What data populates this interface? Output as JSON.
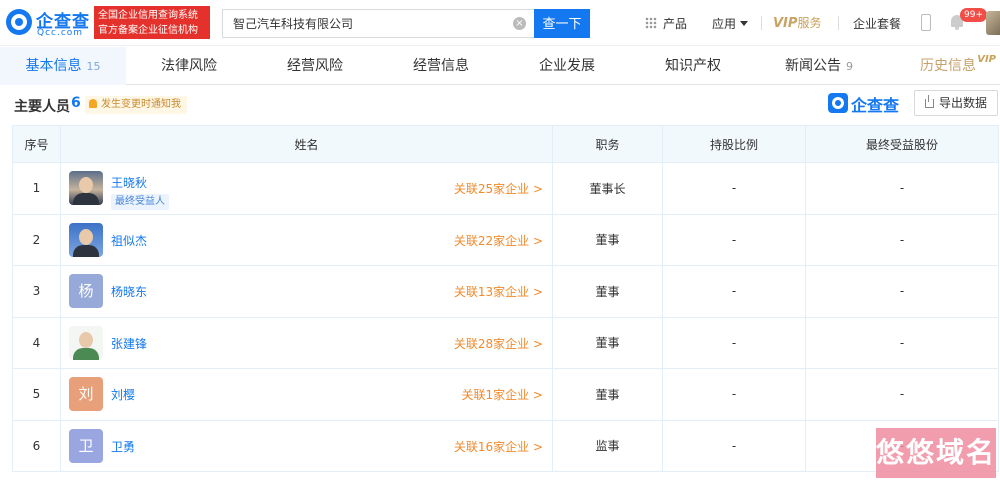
{
  "header": {
    "logo_text": "企查查",
    "logo_sub": "Qcc.com",
    "cert_line1": "全国企业信用查询系统",
    "cert_line2": "官方备案企业征信机构",
    "search_value": "智己汽车科技有限公司",
    "search_button": "查一下",
    "nav_products": "产品",
    "nav_apps": "应用",
    "nav_vip_prefix": "VIP",
    "nav_vip_suffix": "服务",
    "nav_package": "企业套餐",
    "notification_badge": "99+",
    "icons": [
      "grid-icon",
      "caret-down-icon",
      "phone-icon",
      "bell-icon",
      "clear-icon"
    ]
  },
  "tabs": [
    {
      "label": "基本信息",
      "count": "15"
    },
    {
      "label": "法律风险",
      "count": ""
    },
    {
      "label": "经营风险",
      "count": ""
    },
    {
      "label": "经营信息",
      "count": ""
    },
    {
      "label": "企业发展",
      "count": ""
    },
    {
      "label": "知识产权",
      "count": ""
    },
    {
      "label": "新闻公告",
      "count": "9"
    },
    {
      "label": "历史信息",
      "count": "",
      "vip": "VIP"
    }
  ],
  "section": {
    "title": "主要人员",
    "count": "6",
    "notice": "发生变更时通知我",
    "brand": "企查查",
    "export_label": "导出数据"
  },
  "table": {
    "headers": [
      "序号",
      "姓名",
      "职务",
      "持股比例",
      "最终受益股份"
    ],
    "rows": [
      {
        "index": "1",
        "name": "王晓秋",
        "tag": "最终受益人",
        "avatar": "photo",
        "related": "关联25家企业 >",
        "role": "董事长",
        "share": "-",
        "benefit": "-"
      },
      {
        "index": "2",
        "name": "祖似杰",
        "tag": "",
        "avatar": "photo",
        "related": "关联22家企业 >",
        "role": "董事",
        "share": "-",
        "benefit": "-"
      },
      {
        "index": "3",
        "name": "杨晓东",
        "tag": "",
        "avatar": "杨",
        "avatar_color": "#97a9d9",
        "related": "关联13家企业 >",
        "role": "董事",
        "share": "-",
        "benefit": "-"
      },
      {
        "index": "4",
        "name": "张建锋",
        "tag": "",
        "avatar": "photo",
        "related": "关联28家企业 >",
        "role": "董事",
        "share": "-",
        "benefit": "-"
      },
      {
        "index": "5",
        "name": "刘樱",
        "tag": "",
        "avatar": "刘",
        "avatar_color": "#e8a07a",
        "related": "关联1家企业 >",
        "role": "董事",
        "share": "-",
        "benefit": "-"
      },
      {
        "index": "6",
        "name": "卫勇",
        "tag": "",
        "avatar": "卫",
        "avatar_color": "#9aa6e0",
        "related": "关联16家企业 >",
        "role": "监事",
        "share": "-",
        "benefit": "-"
      }
    ]
  },
  "watermark": "悠悠域名",
  "colors": {
    "brand": "#1478f0",
    "link": "#f08a2c",
    "vip": "#c8a15a",
    "cert": "#e5312b"
  }
}
